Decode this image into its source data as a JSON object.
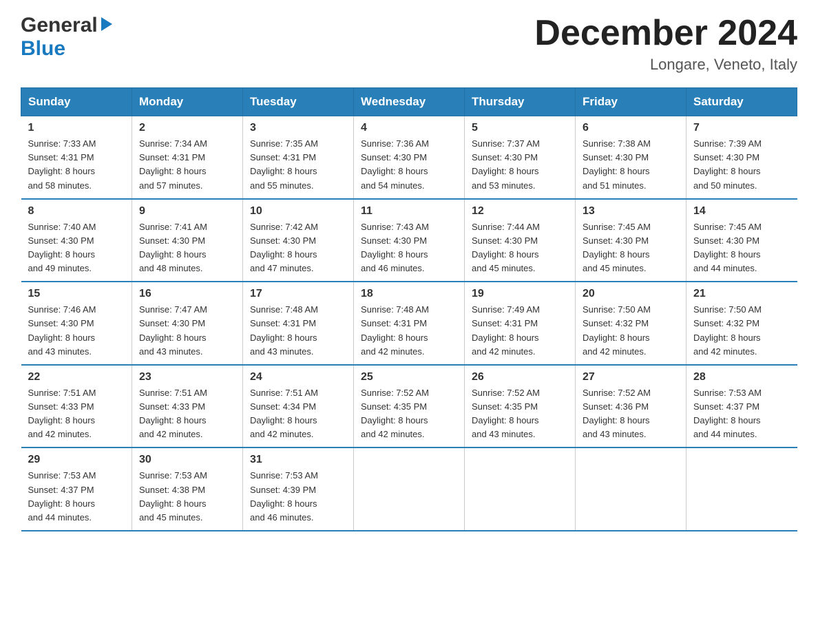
{
  "header": {
    "title": "December 2024",
    "location": "Longare, Veneto, Italy",
    "logo_general": "General",
    "logo_blue": "Blue"
  },
  "weekdays": [
    "Sunday",
    "Monday",
    "Tuesday",
    "Wednesday",
    "Thursday",
    "Friday",
    "Saturday"
  ],
  "weeks": [
    [
      {
        "day": "1",
        "sunrise": "7:33 AM",
        "sunset": "4:31 PM",
        "daylight": "8 hours and 58 minutes."
      },
      {
        "day": "2",
        "sunrise": "7:34 AM",
        "sunset": "4:31 PM",
        "daylight": "8 hours and 57 minutes."
      },
      {
        "day": "3",
        "sunrise": "7:35 AM",
        "sunset": "4:31 PM",
        "daylight": "8 hours and 55 minutes."
      },
      {
        "day": "4",
        "sunrise": "7:36 AM",
        "sunset": "4:30 PM",
        "daylight": "8 hours and 54 minutes."
      },
      {
        "day": "5",
        "sunrise": "7:37 AM",
        "sunset": "4:30 PM",
        "daylight": "8 hours and 53 minutes."
      },
      {
        "day": "6",
        "sunrise": "7:38 AM",
        "sunset": "4:30 PM",
        "daylight": "8 hours and 51 minutes."
      },
      {
        "day": "7",
        "sunrise": "7:39 AM",
        "sunset": "4:30 PM",
        "daylight": "8 hours and 50 minutes."
      }
    ],
    [
      {
        "day": "8",
        "sunrise": "7:40 AM",
        "sunset": "4:30 PM",
        "daylight": "8 hours and 49 minutes."
      },
      {
        "day": "9",
        "sunrise": "7:41 AM",
        "sunset": "4:30 PM",
        "daylight": "8 hours and 48 minutes."
      },
      {
        "day": "10",
        "sunrise": "7:42 AM",
        "sunset": "4:30 PM",
        "daylight": "8 hours and 47 minutes."
      },
      {
        "day": "11",
        "sunrise": "7:43 AM",
        "sunset": "4:30 PM",
        "daylight": "8 hours and 46 minutes."
      },
      {
        "day": "12",
        "sunrise": "7:44 AM",
        "sunset": "4:30 PM",
        "daylight": "8 hours and 45 minutes."
      },
      {
        "day": "13",
        "sunrise": "7:45 AM",
        "sunset": "4:30 PM",
        "daylight": "8 hours and 45 minutes."
      },
      {
        "day": "14",
        "sunrise": "7:45 AM",
        "sunset": "4:30 PM",
        "daylight": "8 hours and 44 minutes."
      }
    ],
    [
      {
        "day": "15",
        "sunrise": "7:46 AM",
        "sunset": "4:30 PM",
        "daylight": "8 hours and 43 minutes."
      },
      {
        "day": "16",
        "sunrise": "7:47 AM",
        "sunset": "4:30 PM",
        "daylight": "8 hours and 43 minutes."
      },
      {
        "day": "17",
        "sunrise": "7:48 AM",
        "sunset": "4:31 PM",
        "daylight": "8 hours and 43 minutes."
      },
      {
        "day": "18",
        "sunrise": "7:48 AM",
        "sunset": "4:31 PM",
        "daylight": "8 hours and 42 minutes."
      },
      {
        "day": "19",
        "sunrise": "7:49 AM",
        "sunset": "4:31 PM",
        "daylight": "8 hours and 42 minutes."
      },
      {
        "day": "20",
        "sunrise": "7:50 AM",
        "sunset": "4:32 PM",
        "daylight": "8 hours and 42 minutes."
      },
      {
        "day": "21",
        "sunrise": "7:50 AM",
        "sunset": "4:32 PM",
        "daylight": "8 hours and 42 minutes."
      }
    ],
    [
      {
        "day": "22",
        "sunrise": "7:51 AM",
        "sunset": "4:33 PM",
        "daylight": "8 hours and 42 minutes."
      },
      {
        "day": "23",
        "sunrise": "7:51 AM",
        "sunset": "4:33 PM",
        "daylight": "8 hours and 42 minutes."
      },
      {
        "day": "24",
        "sunrise": "7:51 AM",
        "sunset": "4:34 PM",
        "daylight": "8 hours and 42 minutes."
      },
      {
        "day": "25",
        "sunrise": "7:52 AM",
        "sunset": "4:35 PM",
        "daylight": "8 hours and 42 minutes."
      },
      {
        "day": "26",
        "sunrise": "7:52 AM",
        "sunset": "4:35 PM",
        "daylight": "8 hours and 43 minutes."
      },
      {
        "day": "27",
        "sunrise": "7:52 AM",
        "sunset": "4:36 PM",
        "daylight": "8 hours and 43 minutes."
      },
      {
        "day": "28",
        "sunrise": "7:53 AM",
        "sunset": "4:37 PM",
        "daylight": "8 hours and 44 minutes."
      }
    ],
    [
      {
        "day": "29",
        "sunrise": "7:53 AM",
        "sunset": "4:37 PM",
        "daylight": "8 hours and 44 minutes."
      },
      {
        "day": "30",
        "sunrise": "7:53 AM",
        "sunset": "4:38 PM",
        "daylight": "8 hours and 45 minutes."
      },
      {
        "day": "31",
        "sunrise": "7:53 AM",
        "sunset": "4:39 PM",
        "daylight": "8 hours and 46 minutes."
      },
      {
        "day": "",
        "sunrise": "",
        "sunset": "",
        "daylight": ""
      },
      {
        "day": "",
        "sunrise": "",
        "sunset": "",
        "daylight": ""
      },
      {
        "day": "",
        "sunrise": "",
        "sunset": "",
        "daylight": ""
      },
      {
        "day": "",
        "sunrise": "",
        "sunset": "",
        "daylight": ""
      }
    ]
  ],
  "labels": {
    "sunrise": "Sunrise: ",
    "sunset": "Sunset: ",
    "daylight": "Daylight: "
  }
}
